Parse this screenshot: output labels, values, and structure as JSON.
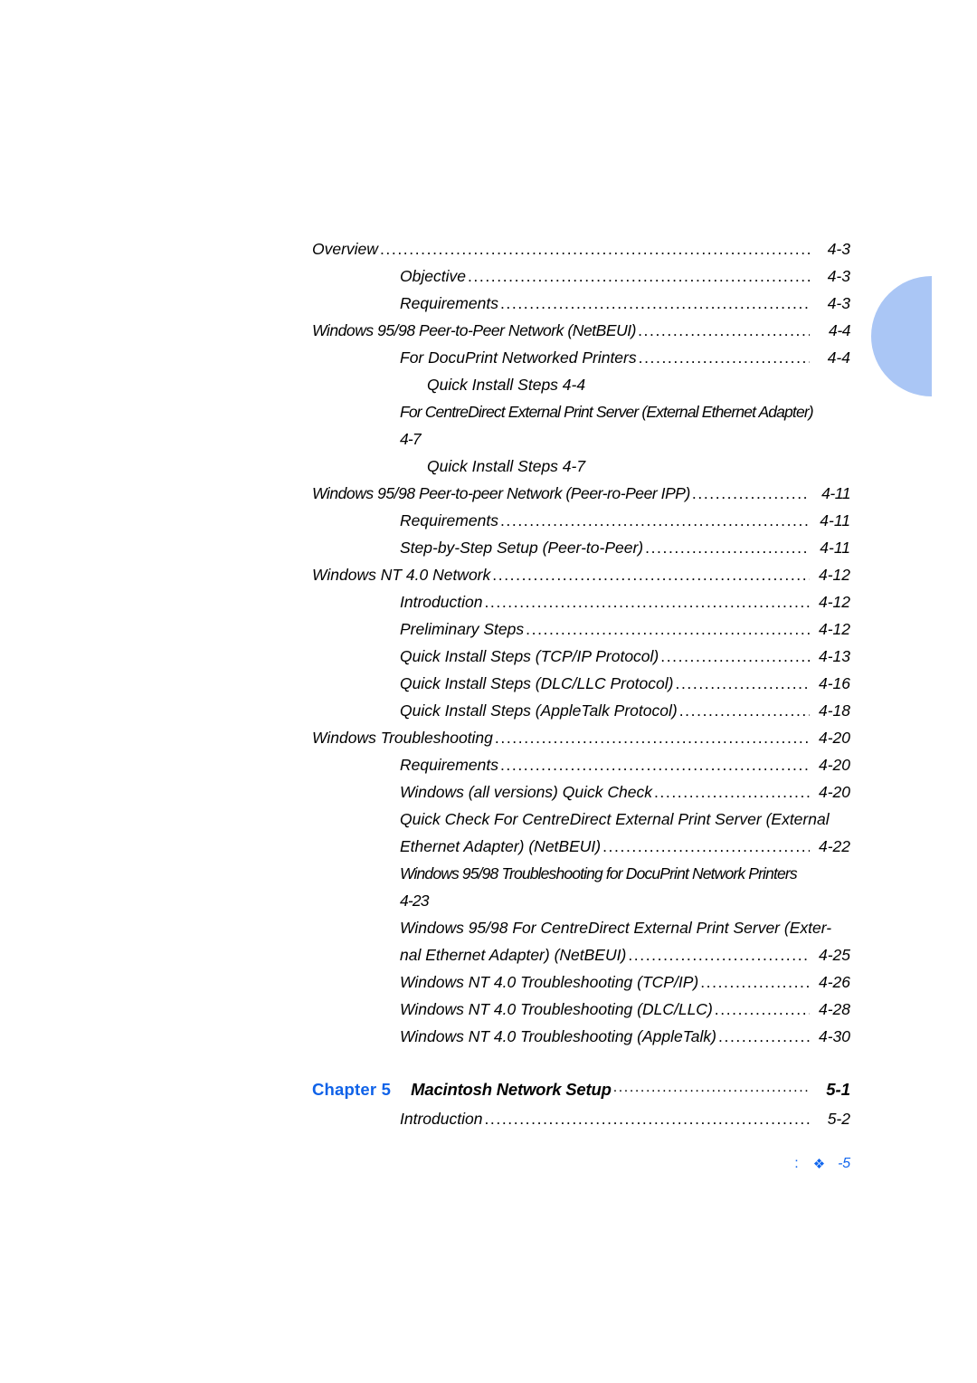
{
  "document": {
    "type": "table-of-contents",
    "accent_color": "#0f62e8",
    "decoration_color": "#aac6f5"
  },
  "toc": {
    "entries": [
      {
        "level": 1,
        "label": "Overview",
        "page": "4-3"
      },
      {
        "level": 2,
        "label": "Objective",
        "page": "4-3"
      },
      {
        "level": 2,
        "label": "Requirements",
        "page": "4-3"
      },
      {
        "level": 1,
        "label": "Windows 95/98 Peer-to-Peer Network (NetBEUI)",
        "page": "4-4"
      },
      {
        "level": 2,
        "label": "For DocuPrint Networked Printers",
        "page": "4-4"
      },
      {
        "level": 3,
        "label": "Quick Install Steps 4-4",
        "page": ""
      },
      {
        "level": 2,
        "label": "For CentreDirect External Print Server (External Ethernet Adapter)",
        "page": "4-7"
      },
      {
        "level": 3,
        "label": "Quick Install Steps 4-7",
        "page": ""
      },
      {
        "level": 1,
        "label": "Windows 95/98 Peer-to-peer Network (Peer-ro-Peer IPP)",
        "page": "4-11"
      },
      {
        "level": 2,
        "label": "Requirements",
        "page": "4-11"
      },
      {
        "level": 2,
        "label": "Step-by-Step Setup (Peer-to-Peer)",
        "page": "4-11"
      },
      {
        "level": 1,
        "label": "Windows NT 4.0 Network",
        "page": "4-12"
      },
      {
        "level": 2,
        "label": "Introduction",
        "page": "4-12"
      },
      {
        "level": 2,
        "label": "Preliminary Steps",
        "page": "4-12"
      },
      {
        "level": 2,
        "label": "Quick Install Steps (TCP/IP Protocol)",
        "page": "4-13"
      },
      {
        "level": 2,
        "label": "Quick Install Steps (DLC/LLC Protocol)",
        "page": "4-16"
      },
      {
        "level": 2,
        "label": "Quick Install Steps (AppleTalk Protocol)",
        "page": "4-18"
      },
      {
        "level": 1,
        "label": "Windows Troubleshooting",
        "page": "4-20"
      },
      {
        "level": 2,
        "label": "Requirements",
        "page": "4-20"
      },
      {
        "level": 2,
        "label": "Windows (all versions) Quick Check",
        "page": "4-20"
      },
      {
        "level": 2,
        "label": "Quick Check For CentreDirect External Print Server (External Ethernet Adapter) (NetBEUI)",
        "page": "4-22"
      },
      {
        "level": 2,
        "label": "Windows 95/98 Troubleshooting for DocuPrint Network Printers 4-23",
        "page": ""
      },
      {
        "level": 2,
        "label": "Windows 95/98 For CentreDirect External Print Server (External Ethernet Adapter) (NetBEUI)",
        "page": "4-25"
      },
      {
        "level": 2,
        "label": "Windows NT 4.0 Troubleshooting (TCP/IP)",
        "page": "4-26"
      },
      {
        "level": 2,
        "label": "Windows NT 4.0 Troubleshooting (DLC/LLC)",
        "page": "4-28"
      },
      {
        "level": 2,
        "label": "Windows NT 4.0 Troubleshooting (AppleTalk)",
        "page": "4-30"
      }
    ],
    "rows": {
      "r0_label": "Overview",
      "r0_page": "4-3",
      "r1_label": "Objective",
      "r1_page": "4-3",
      "r2_label": "Requirements",
      "r2_page": "4-3",
      "r3_label": "Windows 95/98 Peer-to-Peer Network (NetBEUI)",
      "r3_page": "4-4",
      "r4_label": "For DocuPrint Networked Printers",
      "r4_page": "4-4",
      "r5_label": "Quick Install Steps 4-4",
      "r6_line1": "For CentreDirect External Print Server (External Ethernet Adapter)",
      "r6_line2": "4-7",
      "r7_label": "Quick Install Steps 4-7",
      "r8_label": "Windows 95/98 Peer-to-peer Network (Peer-ro-Peer IPP)",
      "r8_page": "4-11",
      "r9_label": "Requirements",
      "r9_page": "4-11",
      "r10_label": "Step-by-Step Setup (Peer-to-Peer)",
      "r10_page": "4-11",
      "r11_label": "Windows NT 4.0 Network",
      "r11_page": "4-12",
      "r12_label": "Introduction",
      "r12_page": "4-12",
      "r13_label": "Preliminary Steps",
      "r13_page": "4-12",
      "r14_label": "Quick Install Steps (TCP/IP Protocol)",
      "r14_page": "4-13",
      "r15_label": "Quick Install Steps (DLC/LLC Protocol)",
      "r15_page": "4-16",
      "r16_label": "Quick Install Steps (AppleTalk Protocol)",
      "r16_page": "4-18",
      "r17_label": "Windows Troubleshooting",
      "r17_page": "4-20",
      "r18_label": "Requirements",
      "r18_page": "4-20",
      "r19_label": "Windows (all versions) Quick Check",
      "r19_page": "4-20",
      "r20_line1": "Quick Check For CentreDirect External Print Server (External",
      "r20_line2": "Ethernet Adapter) (NetBEUI)",
      "r20_page": "4-22",
      "r21_line1": "Windows 95/98 Troubleshooting for DocuPrint Network Printers",
      "r21_line2": "4-23",
      "r22_line1": "Windows 95/98 For CentreDirect External Print Server (Exter-",
      "r22_line2": "nal Ethernet Adapter) (NetBEUI)",
      "r22_page": "4-25",
      "r23_label": "Windows NT 4.0 Troubleshooting (TCP/IP)",
      "r23_page": "4-26",
      "r24_label": "Windows NT 4.0 Troubleshooting (DLC/LLC)",
      "r24_page": "4-28",
      "r25_label": "Windows NT 4.0 Troubleshooting (AppleTalk)",
      "r25_page": "4-30"
    },
    "leader": "........................................................................................................................."
  },
  "chapter": {
    "tag": "Chapter 5",
    "title": "Macintosh Network Setup",
    "page": "5-1",
    "sub_label": "Introduction",
    "sub_page": "5-2"
  },
  "footer": {
    "colon": ":",
    "floret": "❖",
    "page_number": "-5"
  }
}
